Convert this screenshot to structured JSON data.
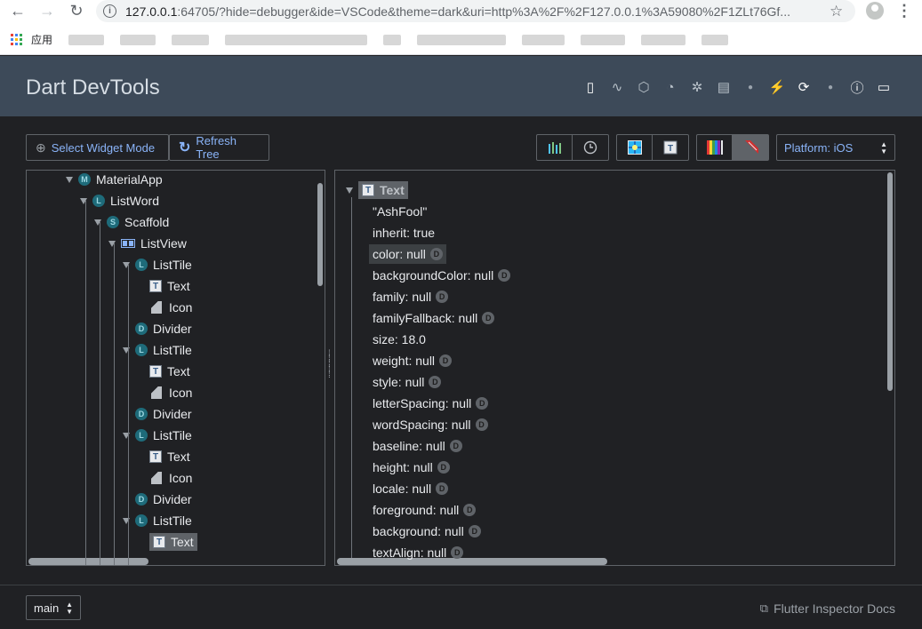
{
  "browser": {
    "url_host": "127.0.0.1",
    "url_rest": ":64705/?hide=debugger&ide=VSCode&theme=dark&uri=http%3A%2F%2F127.0.0.1%3A59080%2F1ZLt76Gf...",
    "apps_label": "应用"
  },
  "devtools": {
    "title": "Dart DevTools",
    "toolbar": {
      "select_widget_mode": "Select Widget Mode",
      "refresh_tree": "Refresh Tree",
      "platform": "Platform: iOS"
    },
    "tree": [
      {
        "label": "MaterialApp",
        "badge": "M",
        "kind": "badge"
      },
      {
        "label": "ListWord",
        "badge": "L",
        "kind": "badge"
      },
      {
        "label": "Scaffold",
        "badge": "S",
        "kind": "badge"
      },
      {
        "label": "ListView",
        "kind": "listview"
      },
      {
        "label": "ListTile",
        "badge": "L",
        "kind": "badge"
      },
      {
        "label": "Text",
        "kind": "text"
      },
      {
        "label": "Icon",
        "kind": "icon"
      },
      {
        "label": "Divider",
        "badge": "D",
        "kind": "badge"
      },
      {
        "label": "ListTile",
        "badge": "L",
        "kind": "badge"
      },
      {
        "label": "Text",
        "kind": "text"
      },
      {
        "label": "Icon",
        "kind": "icon"
      },
      {
        "label": "Divider",
        "badge": "D",
        "kind": "badge"
      },
      {
        "label": "ListTile",
        "badge": "L",
        "kind": "badge"
      },
      {
        "label": "Text",
        "kind": "text"
      },
      {
        "label": "Icon",
        "kind": "icon"
      },
      {
        "label": "Divider",
        "badge": "D",
        "kind": "badge"
      },
      {
        "label": "ListTile",
        "badge": "L",
        "kind": "badge"
      },
      {
        "label": "Text",
        "kind": "text",
        "selected": true
      }
    ],
    "properties": {
      "root": "Text",
      "items": [
        {
          "label": "\"AshFool\"",
          "default": false
        },
        {
          "label": "inherit: true",
          "default": false
        },
        {
          "label": "color: null",
          "default": true
        },
        {
          "label": "backgroundColor: null",
          "default": true
        },
        {
          "label": "family: null",
          "default": true
        },
        {
          "label": "familyFallback: null",
          "default": true
        },
        {
          "label": "size: 18.0",
          "default": false
        },
        {
          "label": "weight: null",
          "default": true
        },
        {
          "label": "style: null",
          "default": true
        },
        {
          "label": "letterSpacing: null",
          "default": true
        },
        {
          "label": "wordSpacing: null",
          "default": true
        },
        {
          "label": "baseline: null",
          "default": true
        },
        {
          "label": "height: null",
          "default": true
        },
        {
          "label": "locale: null",
          "default": true
        },
        {
          "label": "foreground: null",
          "default": true
        },
        {
          "label": "background: null",
          "default": true
        },
        {
          "label": "textAlign: null",
          "default": true
        }
      ],
      "default_badge": "D"
    },
    "footer": {
      "branch": "main",
      "docs_link": "Flutter Inspector Docs"
    }
  }
}
